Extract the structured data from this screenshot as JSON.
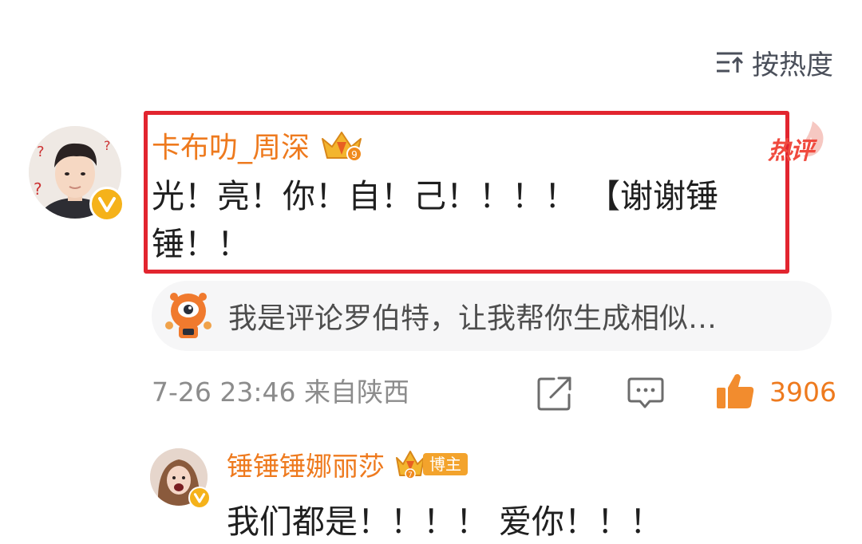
{
  "sort": {
    "icon": "sort-hot-icon",
    "label": "按热度"
  },
  "main_comment": {
    "username": "卡布叻_周深",
    "user_badge_icon": "crown-level-icon",
    "hot_tag": "热评",
    "text": "光！亮！你！自！己！！！！ 【谢谢锤锤！！",
    "time_location": "7-26 23:46 来自陕西",
    "likes": "3906"
  },
  "ai_suggestion": {
    "icon": "comment-robot-icon",
    "text": "我是评论罗伯特，让我帮你生成相似…"
  },
  "reply": {
    "username": "锤锤锤娜丽莎",
    "user_badge_icon": "crown-level-icon",
    "badge": "博主",
    "text": "我们都是！！！！ 爱你！！！"
  },
  "colors": {
    "username": "#ee7a1e",
    "highlight_border": "#e2252f",
    "hot_tag": "#f04a3e",
    "like": "#ee7a1e",
    "meta": "#8c8c8c",
    "verified_badge": "#f5b21a"
  }
}
